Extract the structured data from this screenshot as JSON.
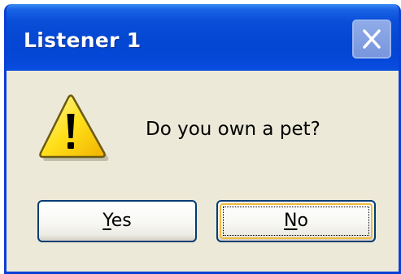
{
  "window": {
    "title": "Listener 1"
  },
  "dialog": {
    "icon": "warning-icon",
    "message": "Do you own a pet?"
  },
  "buttons": {
    "yes": {
      "mnemonic": "Y",
      "rest": "es"
    },
    "no": {
      "mnemonic": "N",
      "rest": "o"
    }
  },
  "colors": {
    "titlebar": "#0347d2",
    "body": "#ece9d8",
    "focus_ring": "#f0b93c"
  }
}
